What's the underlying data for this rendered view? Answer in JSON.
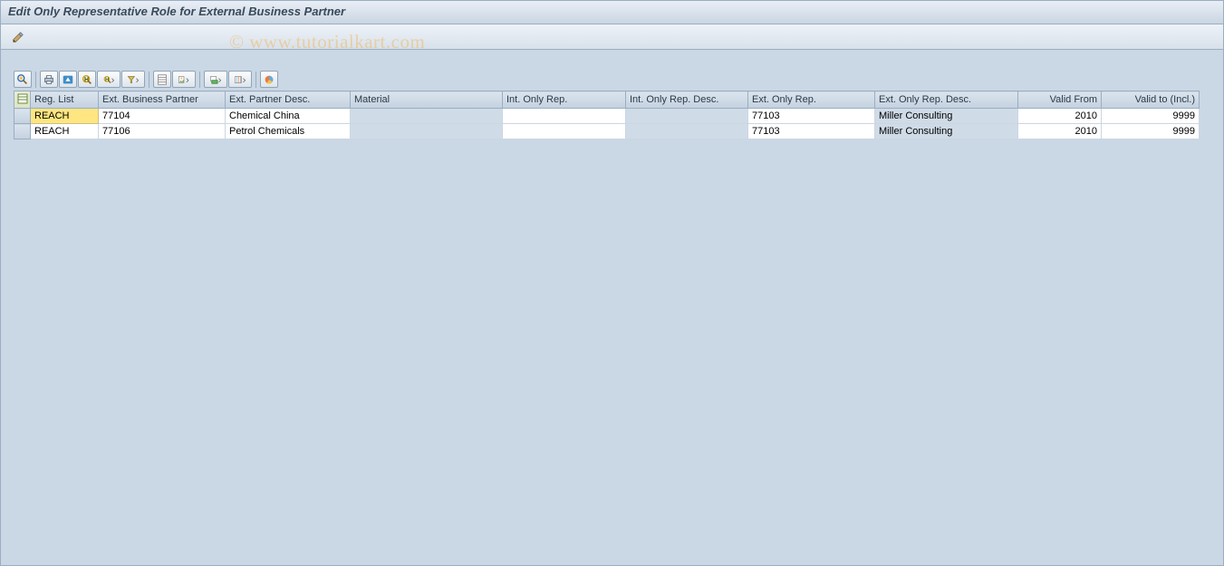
{
  "title": "Edit Only Representative Role for External Business Partner",
  "watermark": "© www.tutorialkart.com",
  "appToolbar": {
    "editIcon": "edit-icon"
  },
  "alvToolbar": [
    "details",
    "print",
    "filter-down",
    "find",
    "find-next",
    "filter-up",
    "separator",
    "export",
    "local-file",
    "export-local",
    "separator",
    "layout",
    "chart"
  ],
  "table": {
    "columns": [
      {
        "key": "reg_list",
        "label": "Reg. List",
        "align": "left"
      },
      {
        "key": "ext_bp",
        "label": "Ext. Business Partner",
        "align": "left"
      },
      {
        "key": "ext_bp_desc",
        "label": "Ext. Partner Desc.",
        "align": "left"
      },
      {
        "key": "material",
        "label": "Material",
        "align": "left"
      },
      {
        "key": "int_only_rep",
        "label": "Int. Only Rep.",
        "align": "left"
      },
      {
        "key": "int_only_rep_desc",
        "label": "Int. Only Rep. Desc.",
        "align": "left"
      },
      {
        "key": "ext_only_rep",
        "label": "Ext. Only Rep.",
        "align": "left"
      },
      {
        "key": "ext_only_rep_desc",
        "label": "Ext. Only Rep. Desc.",
        "align": "left"
      },
      {
        "key": "valid_from",
        "label": "Valid From",
        "align": "right"
      },
      {
        "key": "valid_to",
        "label": "Valid to (Incl.)",
        "align": "right"
      }
    ],
    "rows": [
      {
        "reg_list": "REACH",
        "ext_bp": "77104",
        "ext_bp_desc": "Chemical China",
        "material": "",
        "int_only_rep": "",
        "int_only_rep_desc": "",
        "ext_only_rep": "77103",
        "ext_only_rep_desc": "Miller Consulting",
        "valid_from": "2010",
        "valid_to": "9999"
      },
      {
        "reg_list": "REACH",
        "ext_bp": "77106",
        "ext_bp_desc": "Petrol Chemicals",
        "material": "",
        "int_only_rep": "",
        "int_only_rep_desc": "",
        "ext_only_rep": "77103",
        "ext_only_rep_desc": "Miller Consulting",
        "valid_from": "2010",
        "valid_to": "9999"
      }
    ]
  }
}
